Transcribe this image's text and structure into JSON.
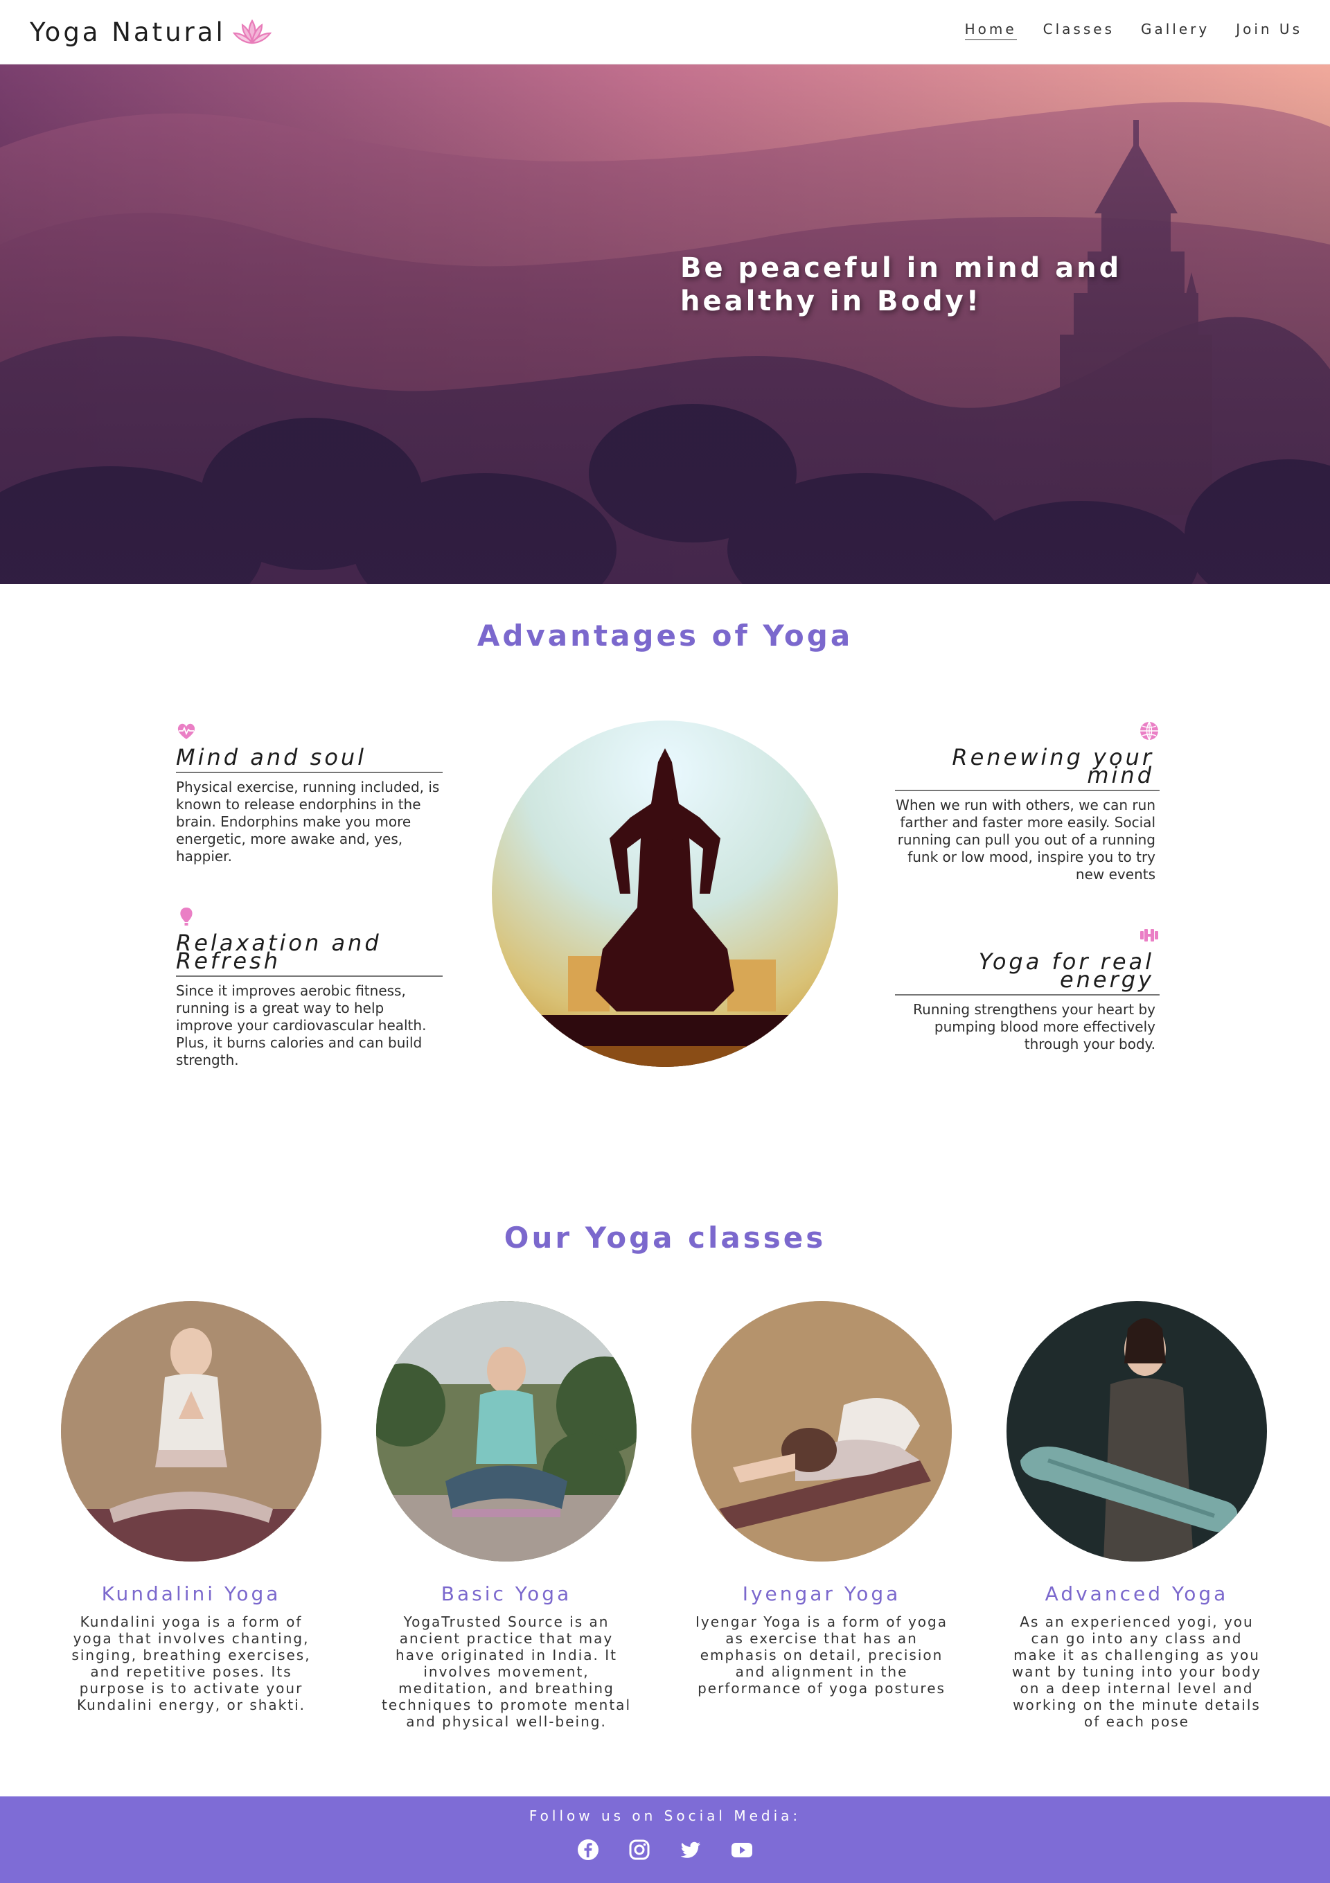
{
  "nav": {
    "brand": "Yoga Natural",
    "brand_icon": "lotus-icon",
    "links": [
      "Home",
      "Classes",
      "Gallery",
      "Join Us"
    ],
    "active": "Home"
  },
  "hero": {
    "tagline": "Be peaceful in mind and healthy in Body!"
  },
  "advantages": {
    "title": "Advantages of Yoga",
    "items": [
      {
        "icon": "heartbeat-icon",
        "title": "Mind and soul",
        "text": "Physical exercise, running included, is known to release endorphins in the brain. Endorphins make you more energetic, more awake and, yes, happier."
      },
      {
        "icon": "hot-air-balloon-icon",
        "title": "Relaxation and Refresh",
        "text": "Since it improves aerobic fitness, running is a great way to help improve your cardiovascular health. Plus, it burns calories and can build strength."
      },
      {
        "icon": "globe-icon",
        "title": "Renewing your mind",
        "text": "When we run with others, we can run farther and faster more easily. Social running can pull you out of a running funk or low mood, inspire you to try new events"
      },
      {
        "icon": "dumbbell-icon",
        "title": "Yoga for real energy",
        "text": "Running strengthens your heart by pumping blood more effectively through your body."
      }
    ]
  },
  "classes": {
    "title": "Our Yoga classes",
    "items": [
      {
        "name": "Kundalini Yoga",
        "text": "Kundalini yoga is a form of yoga that involves chanting, singing, breathing exercises, and repetitive poses. Its purpose is to activate your Kundalini energy, or shakti."
      },
      {
        "name": "Basic Yoga",
        "text": "YogaTrusted Source is an ancient practice that may have originated in India. It involves movement, meditation, and breathing techniques to promote mental and physical well-being."
      },
      {
        "name": "Iyengar Yoga",
        "text": "Iyengar Yoga is a form of yoga as exercise that has an emphasis on detail, precision and alignment in the performance of yoga postures"
      },
      {
        "name": "Advanced Yoga",
        "text": "As an experienced yogi, you can go into any class and make it as challenging as you want by tuning into your body on a deep internal level and working on the minute details of each pose"
      }
    ]
  },
  "footer": {
    "label": "Follow us on Social Media:",
    "social": [
      "facebook-icon",
      "instagram-icon",
      "twitter-icon",
      "youtube-icon"
    ]
  },
  "colors": {
    "accent": "#7b68cd",
    "footer_bg": "#7e6cd6",
    "icon_pink": "#ea7fc5"
  }
}
